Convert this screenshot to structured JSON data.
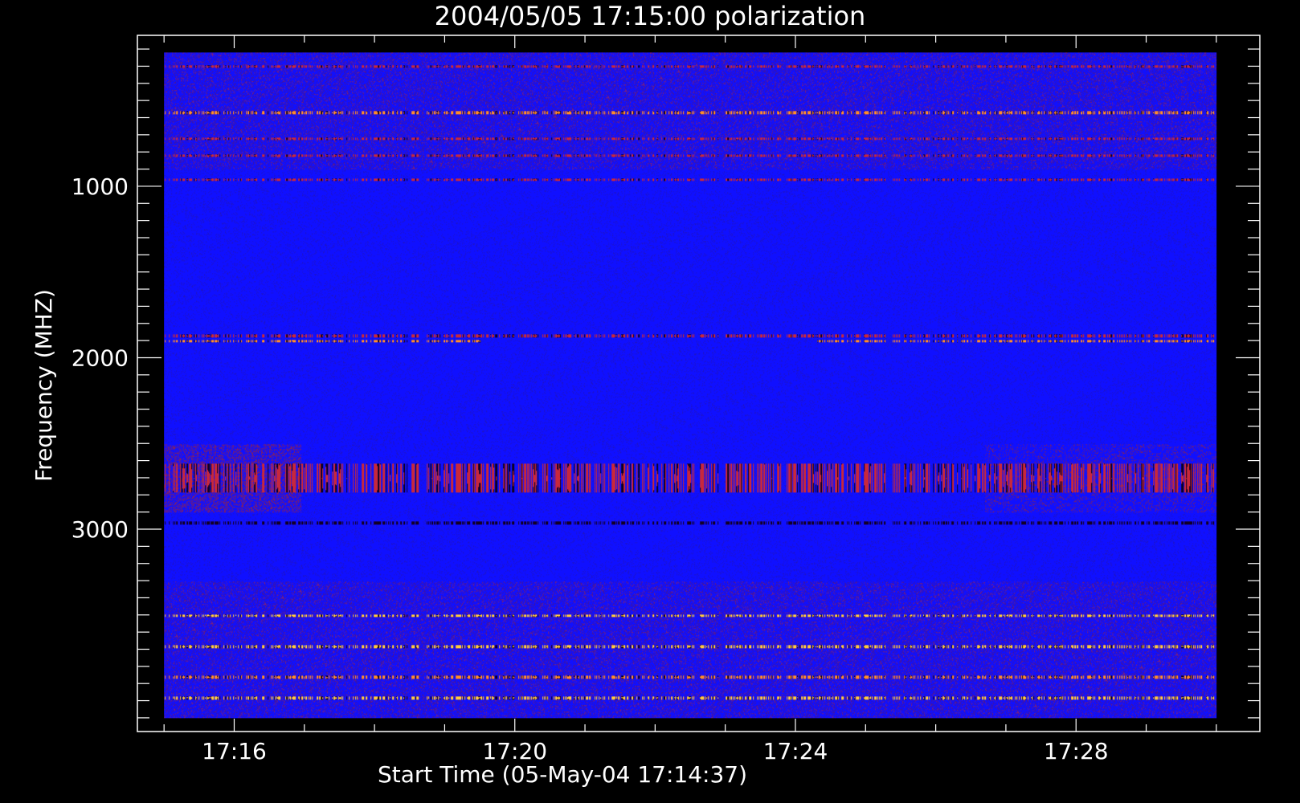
{
  "chart_data": {
    "type": "heatmap",
    "title": "2004/05/05 17:15:00 polarization",
    "xlabel": "Start Time (05-May-04 17:14:37)",
    "ylabel": "Frequency (MHZ)",
    "x_ticks": [
      {
        "label": "17:16",
        "minutes": 16
      },
      {
        "label": "17:20",
        "minutes": 20
      },
      {
        "label": "17:24",
        "minutes": 24
      },
      {
        "label": "17:28",
        "minutes": 28
      }
    ],
    "x_range_minutes": [
      14.62,
      30.62
    ],
    "data_time_range_minutes": [
      15.0,
      30.0
    ],
    "y_ticks": [
      1000,
      2000,
      3000
    ],
    "ylim": [
      120,
      4180
    ],
    "data_freq_range": [
      220,
      4100
    ],
    "y_reversed": true,
    "colormap": [
      "#000000",
      "#1a0a9a",
      "#1010ff",
      "#7a2a9a",
      "#d03030",
      "#ff9020",
      "#ffe070"
    ],
    "background_color": "#1010ff",
    "bands": [
      {
        "freq": 300,
        "kind": "dark-red stripes"
      },
      {
        "freq": 570,
        "kind": "bright red/orange stripes"
      },
      {
        "freq": 720,
        "kind": "orange stripes"
      },
      {
        "freq": 820,
        "kind": "orange stripes"
      },
      {
        "freq": 960,
        "kind": "sporadic red"
      },
      {
        "freq": 1870,
        "kind": "red band (right side)"
      },
      {
        "freq": 1900,
        "kind": "bright orange bursts"
      },
      {
        "freq": 2700,
        "kind": "diffuse red patch (left)"
      },
      {
        "freq": 2960,
        "kind": "dark/red stripes"
      },
      {
        "freq": 3500,
        "kind": "yellow/orange bursts"
      },
      {
        "freq": 3680,
        "kind": "dashed yellow"
      },
      {
        "freq": 3860,
        "kind": "orange/yellow bursts"
      },
      {
        "freq": 3980,
        "kind": "dense orange bursts"
      }
    ],
    "grid": false
  }
}
